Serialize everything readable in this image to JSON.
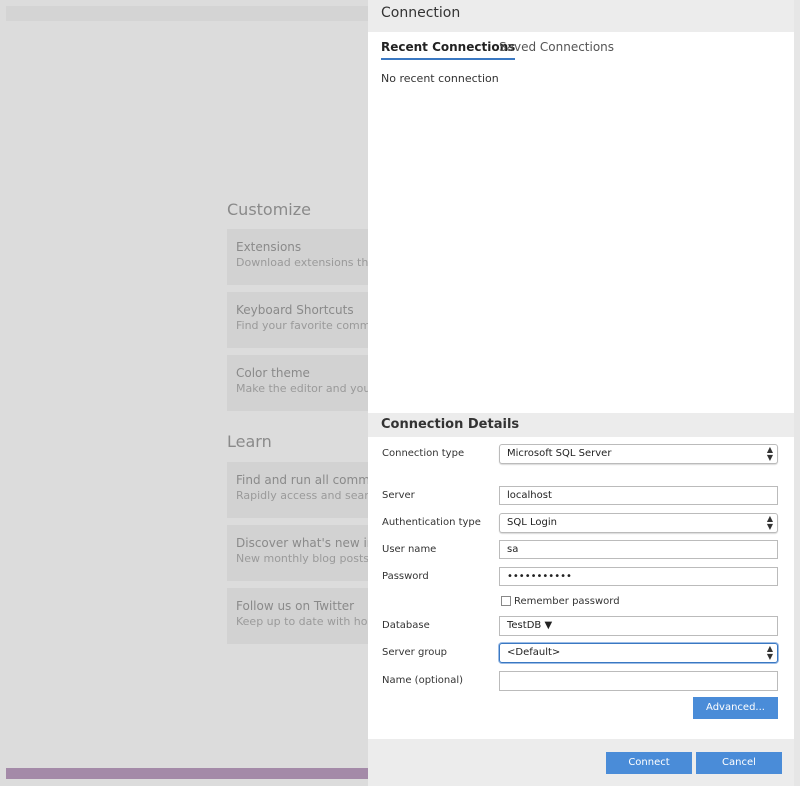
{
  "welcome": {
    "customize_title": "Customize",
    "customize_cards": [
      {
        "title": "Extensions",
        "desc": "Download extensions that"
      },
      {
        "title": "Keyboard Shortcuts",
        "desc": "Find your favorite comma"
      },
      {
        "title": "Color theme",
        "desc": "Make the editor and your"
      }
    ],
    "learn_title": "Learn",
    "learn_cards": [
      {
        "title": "Find and run all command",
        "desc": "Rapidly access and searc"
      },
      {
        "title": "Discover what's new in th",
        "desc": "New monthly blog posts e"
      },
      {
        "title": "Follow us on Twitter",
        "desc": "Keep up to date with how"
      }
    ]
  },
  "dialog": {
    "title": "Connection",
    "tabs": [
      "Recent Connections",
      "Saved Connections"
    ],
    "empty_message": "No recent connection",
    "details_title": "Connection Details",
    "fields": {
      "connection_type": {
        "label": "Connection type",
        "value": "Microsoft SQL Server"
      },
      "server": {
        "label": "Server",
        "value": "localhost"
      },
      "auth_type": {
        "label": "Authentication type",
        "value": "SQL Login"
      },
      "user_name": {
        "label": "User name",
        "value": "sa"
      },
      "password": {
        "label": "Password",
        "value": "•••••••••••"
      },
      "remember": {
        "label": "Remember password",
        "checked": false
      },
      "database": {
        "label": "Database",
        "value": "TestDB"
      },
      "server_group": {
        "label": "Server group",
        "value": "<Default>"
      },
      "name": {
        "label": "Name (optional)",
        "value": ""
      }
    },
    "advanced_button": "Advanced...",
    "connect_button": "Connect",
    "cancel_button": "Cancel"
  },
  "colors": {
    "accent": "#4a8cd8",
    "statusbar": "#a48aa8",
    "tab_underline": "#3a78c2"
  },
  "icons": {
    "select_arrows": "up-down-chevron-icon",
    "dropdown_arrow": "caret-down-icon"
  }
}
